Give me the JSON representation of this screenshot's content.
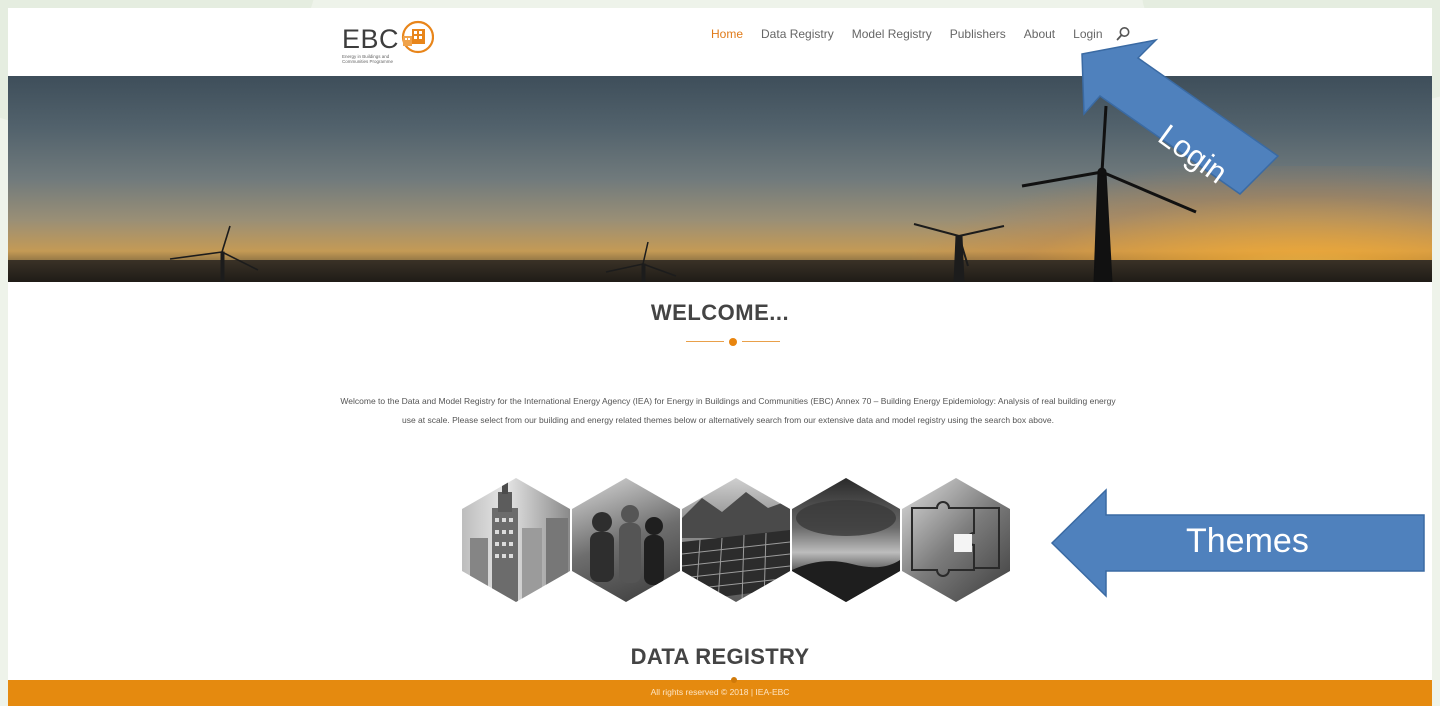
{
  "logo": {
    "wordmark": "EBC",
    "subtitle": "Energy in Buildings and Communities Programme"
  },
  "nav": {
    "items": [
      {
        "label": "Home",
        "active": true
      },
      {
        "label": "Data Registry",
        "active": false
      },
      {
        "label": "Model Registry",
        "active": false
      },
      {
        "label": "Publishers",
        "active": false
      },
      {
        "label": "About",
        "active": false
      },
      {
        "label": "Login",
        "active": false
      }
    ],
    "search_icon": "search-icon"
  },
  "annotations": {
    "login_label": "Login",
    "themes_label": "Themes",
    "arrow_color": "#4f81bd"
  },
  "welcome": {
    "title": "WELCOME...",
    "body": "Welcome to the Data and Model Registry for the International Energy Agency (IEA) for Energy in Buildings and Communities (EBC) Annex 70 – Building Energy Epidemiology: Analysis of real building energy use at scale. Please select from our building and energy related themes below or alternatively search from our extensive data and model registry using the search box above."
  },
  "themes": [
    {
      "name": "buildings-theme"
    },
    {
      "name": "people-theme"
    },
    {
      "name": "solar-theme"
    },
    {
      "name": "climate-theme"
    },
    {
      "name": "puzzle-theme"
    }
  ],
  "data_registry": {
    "title": "DATA REGISTRY"
  },
  "footer": {
    "text": "All rights reserved © 2018 | IEA-EBC"
  },
  "colors": {
    "accent": "#e07b1a",
    "footer": "#e58a0f",
    "text": "#444444"
  }
}
